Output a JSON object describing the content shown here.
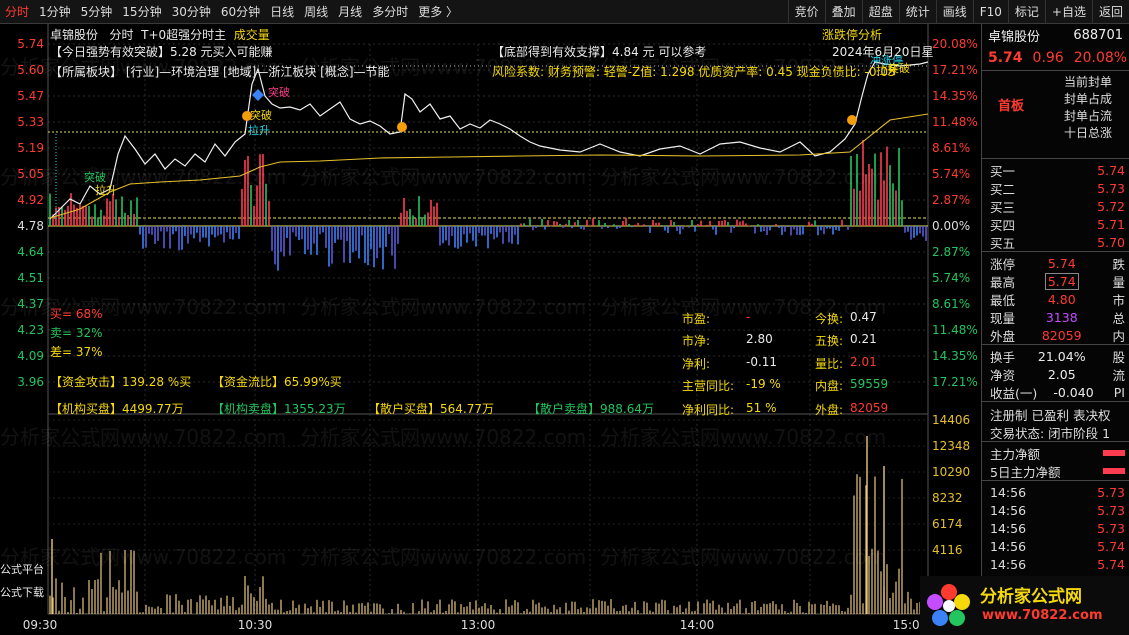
{
  "toolbar": {
    "periods": [
      "分时",
      "1分钟",
      "5分钟",
      "15分钟",
      "30分钟",
      "60分钟",
      "日线",
      "周线",
      "月线",
      "多分时",
      "更多 〉"
    ],
    "active_period": "分时",
    "tools": [
      "竞价",
      "叠加",
      "超盘",
      "统计",
      "画线",
      "F10",
      "标记",
      "+自选",
      "返回"
    ]
  },
  "chart": {
    "header": {
      "name": "卓锦股份",
      "mode": "分时",
      "formula": "T+0超强分时主",
      "indicator": "成交量",
      "right_link": "涨跌停分析"
    },
    "signals": {
      "strong": "【今日强势有效突破】5.28 元买入可能赚",
      "bottom": "【底部得到有效支撑】4.84 元 可以参考",
      "date": "2024年6月20日星",
      "sector": "【所属板块】 [行业]—环境治理 [地域]—浙江板块 [概念]—节能",
      "risk": "风险系数: 财务预警: 轻警-Z值: 1.298 优质资产率: 0.45 现金负债比: -0.05"
    },
    "annotations": [
      "突破",
      "拉升",
      "突破",
      "拉升",
      "突破",
      "冲涨停",
      "拉升",
      "突破"
    ],
    "y_left": [
      "5.74",
      "5.60",
      "5.47",
      "5.33",
      "5.19",
      "5.05",
      "4.92",
      "4.78",
      "4.64",
      "4.51",
      "4.37",
      "4.23",
      "4.09",
      "3.96"
    ],
    "y_right": [
      "20.08%",
      "17.21%",
      "14.35%",
      "11.48%",
      "8.61%",
      "5.74%",
      "2.87%",
      "0.00%",
      "2.87%",
      "5.74%",
      "8.61%",
      "11.48%",
      "14.35%",
      "17.21%"
    ],
    "vol_axis": [
      "14406",
      "12348",
      "10290",
      "8232",
      "6174",
      "4116"
    ],
    "x_axis": [
      "09:30",
      "10:30",
      "13:00",
      "14:00",
      "15:00"
    ],
    "left_labels": {
      "buy": "买= 68%",
      "sell": "卖= 32%",
      "diff": "差= 37%",
      "formula_platform": "公式平台",
      "formula_download": "公式下载"
    },
    "money": {
      "attack": "【资金攻击】139.28 %买",
      "flow": "【资金流比】65.99%买",
      "inst_buy": "【机构买盘】4499.77万",
      "inst_sell": "【机构卖盘】1355.23万",
      "retail_buy": "【散户买盘】564.77万",
      "retail_sell": "【散户卖盘】988.64万"
    },
    "fundamentals": {
      "pe_label": "市盈:",
      "pe_val": "-",
      "pb_label": "市净:",
      "pb_val": "2.80",
      "profit_label": "净利:",
      "profit_val": "-0.11",
      "main_yoy_label": "主营同比:",
      "main_yoy_val": "-19 %",
      "net_yoy_label": "净利同比:",
      "net_yoy_val": "51 %",
      "turn_label": "今换:",
      "turn_val": "0.47",
      "turn5_label": "五换:",
      "turn5_val": "0.21",
      "vr_label": "量比:",
      "vr_val": "2.01",
      "inner_label": "内盘:",
      "inner_val": "59559",
      "outer_label": "外盘:",
      "outer_val": "82059"
    },
    "watermark": "分析家公式网www.70822.com"
  },
  "panel": {
    "name": "卓锦股份",
    "code": "688701",
    "price": "5.74",
    "change": "0.96",
    "pct": "20.08%",
    "tag": "首板",
    "limit_notes": [
      "当前封单",
      "封单占成",
      "封单占流",
      "十日总涨"
    ],
    "book": [
      {
        "label": "买一",
        "price": "5.74"
      },
      {
        "label": "买二",
        "price": "5.73"
      },
      {
        "label": "买三",
        "price": "5.72"
      },
      {
        "label": "买四",
        "price": "5.71"
      },
      {
        "label": "买五",
        "price": "5.70"
      }
    ],
    "quote": [
      {
        "k": "涨停",
        "v": "5.74",
        "tail": "跌"
      },
      {
        "k": "最高",
        "v": "5.74",
        "tail": "量"
      },
      {
        "k": "最低",
        "v": "4.80",
        "tail": "市"
      },
      {
        "k": "现量",
        "v": "3138",
        "tail": "总"
      },
      {
        "k": "外盘",
        "v": "82059",
        "tail": "内"
      }
    ],
    "stats": [
      {
        "k": "换手",
        "v": "21.04%",
        "tail": "股"
      },
      {
        "k": "净资",
        "v": "2.05",
        "tail": "流"
      },
      {
        "k": "收益(一)",
        "v": "-0.040",
        "tail": "PI"
      }
    ],
    "reg": "注册制 已盈利 表决权",
    "state": "交易状态: 闭市阶段 1",
    "main_net": "主力净额",
    "main_net5": "5日主力净额",
    "ticks": [
      {
        "t": "14:56",
        "p": "5.73"
      },
      {
        "t": "14:56",
        "p": "5.73"
      },
      {
        "t": "14:56",
        "p": "5.73"
      },
      {
        "t": "14:56",
        "p": "5.74"
      },
      {
        "t": "14:56",
        "p": "5.74"
      }
    ],
    "logo_text": "分析家公式网",
    "logo_url": "www.70822.com"
  }
}
